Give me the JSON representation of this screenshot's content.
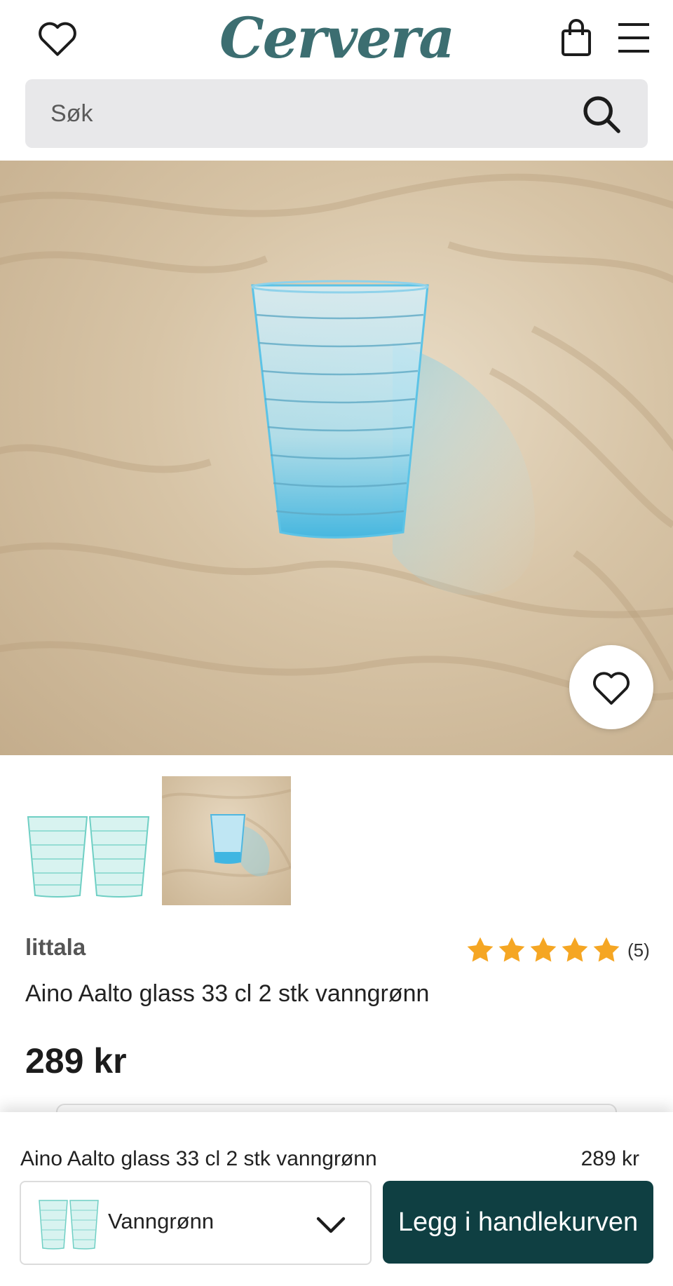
{
  "header": {
    "logo": "Cervera",
    "wishlist_icon": "heart-icon",
    "cart_icon": "shopping-bag-icon",
    "menu_icon": "hamburger-menu-icon"
  },
  "search": {
    "placeholder": "Søk",
    "icon": "search-icon"
  },
  "product": {
    "brand": "littala",
    "rating_stars": 5,
    "rating_count": "(5)",
    "title": "Aino Aalto glass 33 cl 2 stk vanngrønn",
    "price": "289 kr"
  },
  "sticky_bar": {
    "title": "Aino Aalto glass 33 cl 2 stk vanngrønn",
    "price": "289 kr",
    "variant_selected": "Vanngrønn",
    "add_to_cart_label": "Legg i handlekurven"
  },
  "colors": {
    "brand": "#3c6e71",
    "cta_bg": "#0f3f42",
    "star": "#f5a623",
    "search_bg": "#e8e8ea"
  }
}
